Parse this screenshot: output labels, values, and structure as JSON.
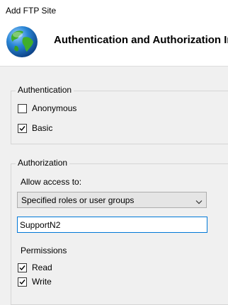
{
  "window": {
    "title": "Add FTP Site"
  },
  "header": {
    "title": "Authentication and Authorization Information",
    "icon": "globe-icon"
  },
  "authentication": {
    "group_label": "Authentication",
    "anonymous": {
      "label": "Anonymous",
      "checked": false
    },
    "basic": {
      "label": "Basic",
      "checked": true
    }
  },
  "authorization": {
    "group_label": "Authorization",
    "allow_access_label": "Allow access to:",
    "allow_access_selected": "Specified roles or user groups",
    "users_value": "SupportN2",
    "permissions_label": "Permissions",
    "read": {
      "label": "Read",
      "checked": true
    },
    "write": {
      "label": "Write",
      "checked": true
    }
  },
  "colors": {
    "focus_border": "#0078d7",
    "dialog_background": "#f0f0f0",
    "globe_ocean": "#1f78c8",
    "globe_land": "#3fae2a"
  }
}
